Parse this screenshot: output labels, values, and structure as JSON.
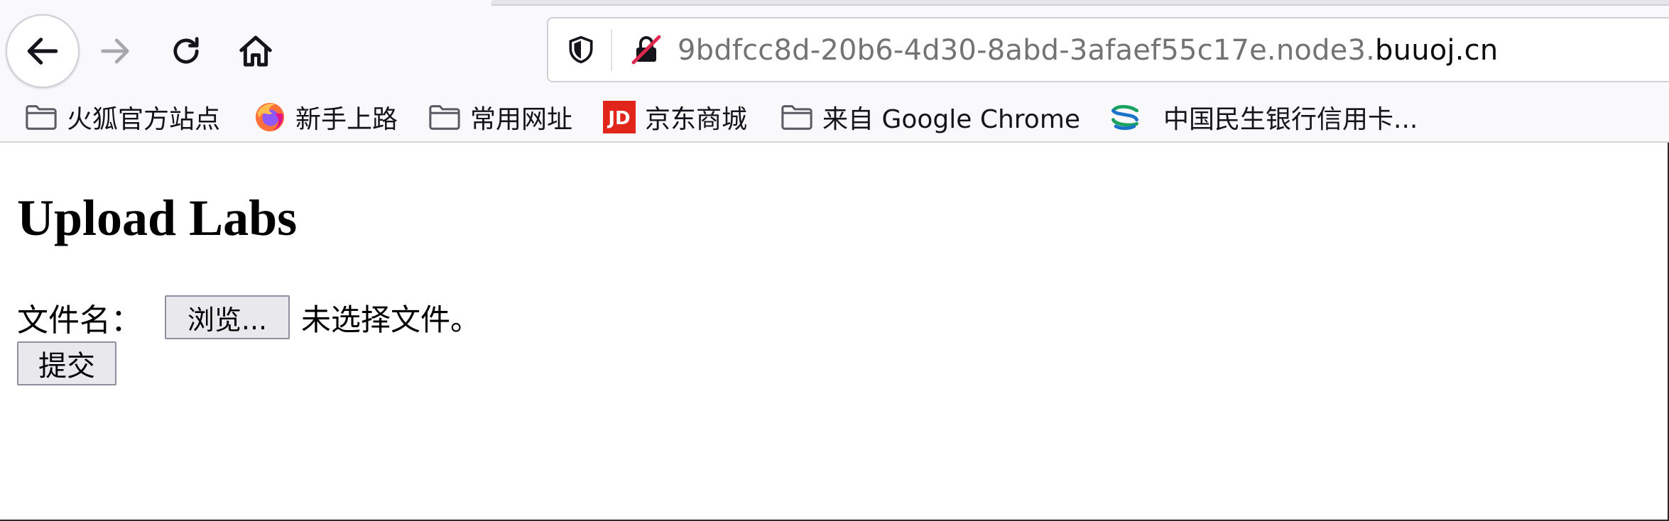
{
  "browser": {
    "url_prefix": "9bdfcc8d-20b6-4d30-8abd-3afaef55c17e.node3.",
    "url_domain": "buuoj.cn",
    "bookmarks": [
      {
        "label": "火狐官方站点",
        "icon": "folder-icon"
      },
      {
        "label": "新手上路",
        "icon": "firefox-icon"
      },
      {
        "label": "常用网址",
        "icon": "folder-icon"
      },
      {
        "label": "京东商城",
        "icon": "jd-icon"
      },
      {
        "label": "来自 Google Chrome",
        "icon": "folder-icon"
      },
      {
        "label": "中国民生银行信用卡...",
        "icon": "cmbc-icon"
      }
    ],
    "jd_logo_text": "JD",
    "colors": {
      "accent_red": "#e1251b",
      "firefox_orange": "#ff7139",
      "cmbc_green": "#1aa260",
      "cmbc_blue": "#1a73c9"
    }
  },
  "page": {
    "title": "Upload Labs",
    "file_label": "文件名：",
    "browse_label": "浏览...",
    "no_file_text": "未选择文件。",
    "submit_label": "提交"
  }
}
